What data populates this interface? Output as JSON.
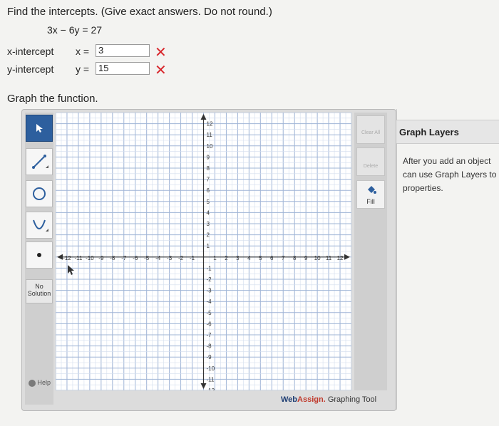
{
  "question": {
    "prompt": "Find the intercepts. (Give exact answers. Do not round.)",
    "equation": "3x − 6y = 27",
    "x_intercept": {
      "label": "x-intercept",
      "var": "x =",
      "value": "3",
      "status": "incorrect"
    },
    "y_intercept": {
      "label": "y-intercept",
      "var": "y =",
      "value": "15",
      "status": "incorrect"
    },
    "wrong_mark": "✕",
    "graph_prompt": "Graph the function."
  },
  "tool": {
    "left_tools": [
      {
        "name": "pointer",
        "icon": "pointer-arrow-icon",
        "active": true
      },
      {
        "name": "line",
        "icon": "line-segment-icon",
        "active": false
      },
      {
        "name": "circle",
        "icon": "circle-icon",
        "active": false
      },
      {
        "name": "parabola",
        "icon": "parabola-icon",
        "active": false
      },
      {
        "name": "point",
        "icon": "point-dot-icon",
        "active": false
      }
    ],
    "no_solution_label": "No Solution",
    "help_label": "Help",
    "clear_all_label": "Clear All",
    "delete_label": "Delete",
    "fill_label": "Fill",
    "brand_w": "Web",
    "brand_a": "Assign.",
    "brand_rest": " Graphing Tool",
    "grid": {
      "xmin": -13,
      "xmax": 13,
      "ymin": -12,
      "ymax": 13
    }
  },
  "layers": {
    "title": "Graph Layers",
    "line1": "After you add an object",
    "line2": "can use Graph Layers to",
    "line3": "properties."
  },
  "colors": {
    "wrong": "#d8262c",
    "active_tool": "#2d5f9e"
  }
}
